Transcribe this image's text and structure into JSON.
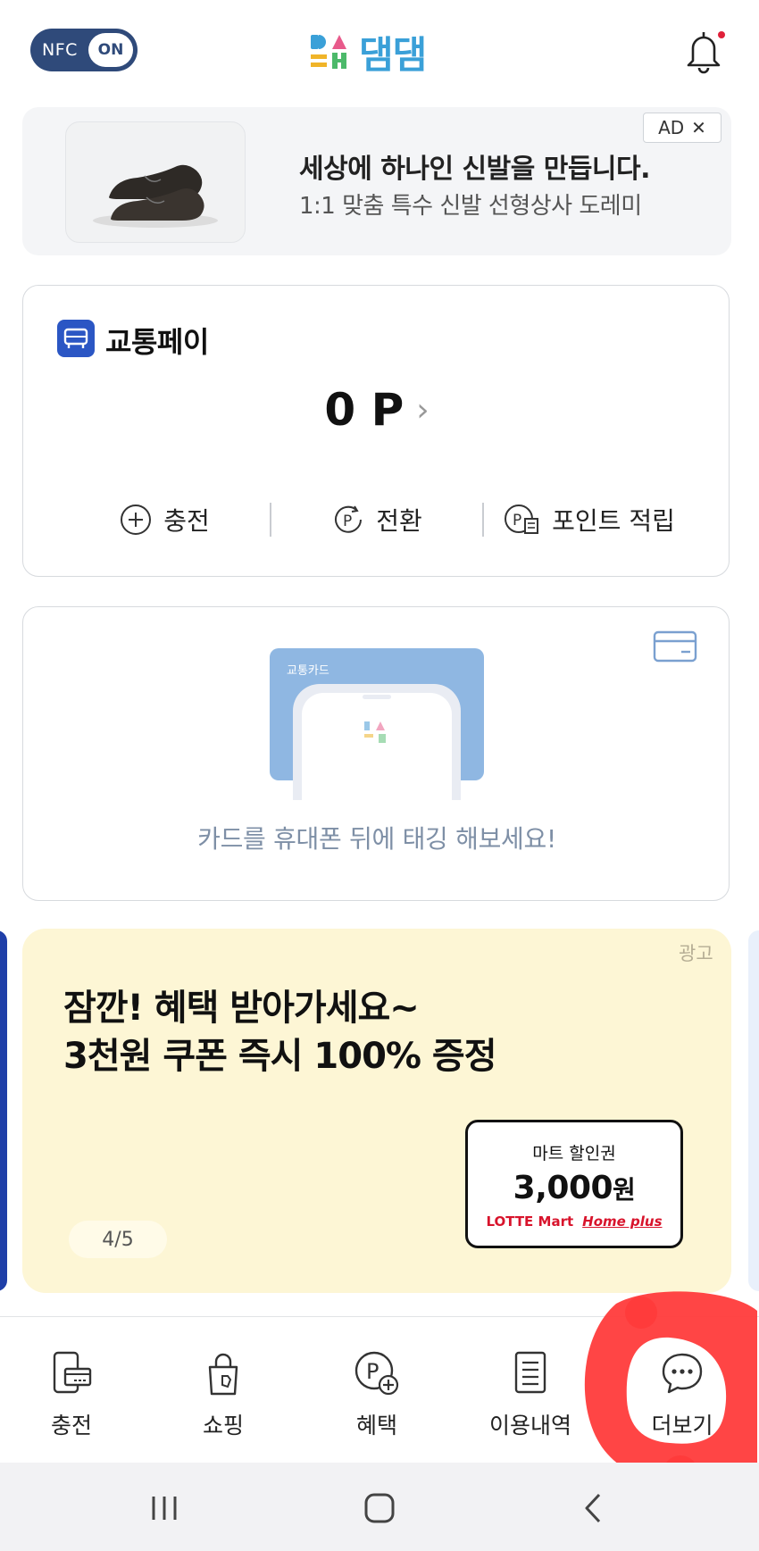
{
  "header": {
    "nfc_label": "NFC",
    "nfc_state": "ON",
    "logo_text": "댐댐",
    "logo_icon": "dam-blocks-logo",
    "bell_icon": "bell-icon",
    "has_notification_dot": true
  },
  "ad_banner": {
    "title": "세상에 하나인 신발을 만듭니다.",
    "subtitle": "1:1 맞춤 특수 신발 선형상사 도레미",
    "badge": "AD",
    "close_icon": "close-icon",
    "image": "leather-shoes-thumbnail"
  },
  "pay_card": {
    "title": "교통페이",
    "icon": "bus-icon",
    "balance": "0 P",
    "arrow": "›",
    "actions": [
      {
        "label": "충전",
        "icon": "plus-circle-icon"
      },
      {
        "label": "전환",
        "icon": "point-convert-icon"
      },
      {
        "label": "포인트 적립",
        "icon": "point-receipt-icon"
      }
    ]
  },
  "tag_card": {
    "card_label": "교통카드",
    "message": "카드를 휴대폰 뒤에 태깅 해보세요!",
    "icon": "card-icon"
  },
  "promo": {
    "ad_label": "광고",
    "line1": "잠깐! 혜택 받아가세요~",
    "line2": "3천원 쿠폰 즉시 100% 증정",
    "coupon": {
      "label": "마트 할인권",
      "amount": "3,000",
      "unit": "원",
      "brand1": "LOTTE Mart",
      "brand2": "Home plus"
    },
    "page_indicator": "4/5"
  },
  "bottom_nav": [
    {
      "label": "충전",
      "icon": "phone-card-icon"
    },
    {
      "label": "쇼핑",
      "icon": "shopping-bag-icon"
    },
    {
      "label": "혜택",
      "icon": "point-plus-icon"
    },
    {
      "label": "이용내역",
      "icon": "document-list-icon"
    },
    {
      "label": "더보기",
      "icon": "chat-more-icon"
    }
  ],
  "system_nav": [
    "recent-apps-icon",
    "home-icon",
    "back-icon"
  ],
  "colors": {
    "primary_blue": "#2b56c4",
    "nfc_bg": "#2f4a7a",
    "promo_bg": "#fdf6d5",
    "highlight_red": "#ff3b3b"
  }
}
